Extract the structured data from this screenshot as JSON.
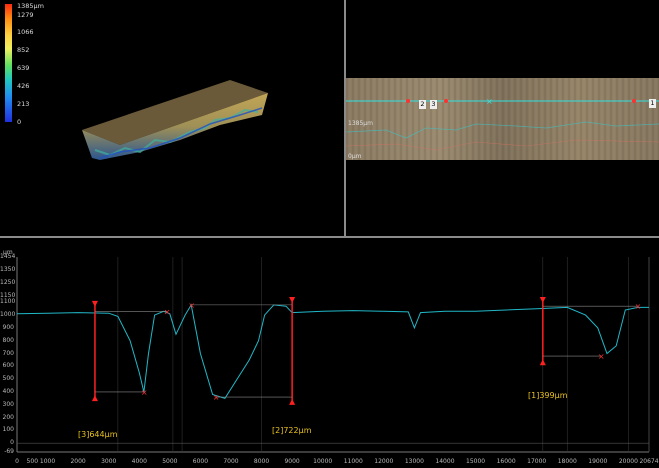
{
  "legend": {
    "labels": [
      "1385µm",
      "1279",
      "1066",
      "852",
      "639",
      "426",
      "213",
      "0"
    ]
  },
  "image_view": {
    "markers": [
      "2",
      "3",
      "1"
    ],
    "depth_label": "1385µm",
    "unit_label": "0µm"
  },
  "profile": {
    "unit": "µm",
    "y_ticks": [
      "1454",
      "1350",
      "1250",
      "1150",
      "1100",
      "1000",
      "900",
      "800",
      "700",
      "600",
      "500",
      "400",
      "300",
      "200",
      "100",
      "0",
      "-69"
    ],
    "x_ticks": [
      "0",
      "500",
      "1000",
      "2000",
      "3000",
      "4000",
      "5000",
      "6000",
      "7000",
      "8000",
      "9000",
      "10000",
      "11000",
      "12000",
      "13000",
      "14000",
      "15000",
      "16000",
      "17000",
      "18000",
      "19000",
      "20000",
      "20674"
    ],
    "measurements": [
      {
        "label": "[3]644µm"
      },
      {
        "label": "[2]722µm"
      },
      {
        "label": "[1]399µm"
      }
    ]
  },
  "chart_data": {
    "type": "line",
    "xlabel": "",
    "ylabel": "µm",
    "xlim": [
      0,
      20674
    ],
    "ylim": [
      -69,
      1454
    ],
    "x": [
      0,
      1000,
      2000,
      3000,
      3300,
      3700,
      4000,
      4150,
      4300,
      4500,
      4800,
      5000,
      5200,
      5500,
      5700,
      6000,
      6400,
      6800,
      7200,
      7600,
      7900,
      8100,
      8400,
      8800,
      9000,
      10000,
      11000,
      12000,
      12800,
      13000,
      13200,
      14000,
      15000,
      16000,
      17000,
      18000,
      18600,
      19000,
      19300,
      19600,
      19900,
      20300,
      20674
    ],
    "y": [
      1010,
      1015,
      1020,
      1015,
      990,
      800,
      550,
      400,
      700,
      1000,
      1030,
      1010,
      850,
      1000,
      1080,
      700,
      380,
      350,
      500,
      650,
      800,
      1000,
      1080,
      1070,
      1020,
      1030,
      1035,
      1030,
      1025,
      900,
      1020,
      1030,
      1030,
      1040,
      1050,
      1060,
      1000,
      900,
      700,
      760,
      1040,
      1060,
      1060
    ]
  }
}
